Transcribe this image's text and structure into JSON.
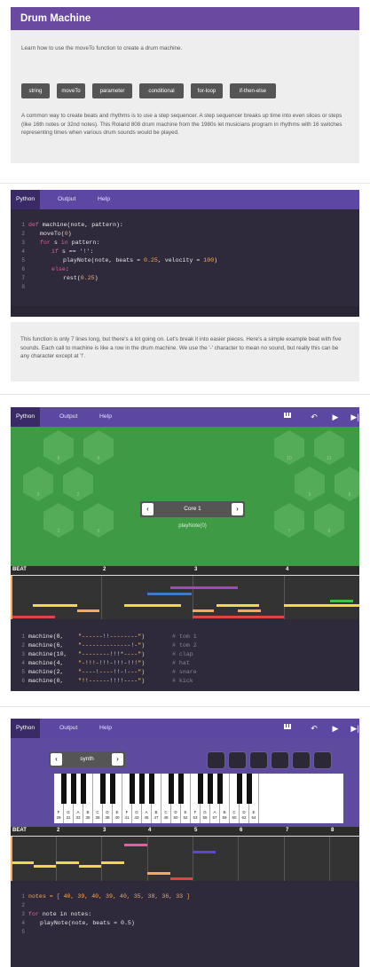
{
  "lesson": {
    "title": "Drum Machine",
    "intro": "Learn how to use the moveTo function to create a drum machine.",
    "tags": [
      "string",
      "moveTo",
      "parameter",
      "conditional",
      "for-loop",
      "if-then-else"
    ],
    "body": "A common way to create beats and rhythms is to use a step sequencer. A step sequencer breaks up time into even slices or steps (like 16th notes or 32nd notes). This Roland 808 drum machine from the 1980s let musicians program in rhythms with 16 switches representing times when various drum sounds would be played."
  },
  "editor1": {
    "tabs": [
      "Python",
      "Output",
      "Help"
    ],
    "active_tab": "Python",
    "line_numbers": [
      "1",
      "2",
      "3",
      "4",
      "5",
      "6",
      "7",
      "8"
    ]
  },
  "paragraph": "This function is only 7 lines long, but there's a lot going on. Let's break it into easier pieces. Here's a simple example beat with five sounds. Each call to machine is like a row in the drum machine. We use the '-' character to mean no sound, but really this can be any character except at '!'.",
  "editor2": {
    "tabs": [
      "Python",
      "Output",
      "Help"
    ],
    "controls": [
      "piano-icon",
      "undo-icon",
      "play-icon",
      "step-icon"
    ],
    "core_label": "Core 1",
    "core_status": "playNote(0)",
    "hex_numbers": [
      "6",
      "5",
      "3",
      "2",
      "1",
      "0",
      "10",
      "11",
      "9",
      "8",
      "7",
      "6"
    ],
    "beat_label": "BEAT",
    "beat_numbers": [
      "2",
      "3",
      "4"
    ],
    "code_lines": [
      {
        "n": "1",
        "call": "machine(8,",
        "pat": "\"------!!--------\")",
        "cmt": "# tom 1"
      },
      {
        "n": "2",
        "call": "machine(6,",
        "pat": "\"--------------!-\")",
        "cmt": "# tom 2"
      },
      {
        "n": "3",
        "call": "machine(10,",
        "pat": "\"--------!!!*----\")",
        "cmt": "# clap"
      },
      {
        "n": "4",
        "call": "machine(4,",
        "pat": "\"-!!!-!!!-!!!-!!!\")",
        "cmt": "# hat"
      },
      {
        "n": "5",
        "call": "machine(2,",
        "pat": "\"----!----!!-!---\")",
        "cmt": "# snare"
      },
      {
        "n": "6",
        "call": "machine(0,",
        "pat": "\"!!------!!!!----\")",
        "cmt": "# kick"
      }
    ]
  },
  "editor3": {
    "tabs": [
      "Python",
      "Output",
      "Help"
    ],
    "controls": [
      "piano-icon",
      "undo-icon",
      "play-icon",
      "step-icon"
    ],
    "instrument": "synth",
    "keys_notes": [
      "F",
      "G",
      "A",
      "B",
      "C",
      "D",
      "E",
      "F",
      "G",
      "A",
      "B",
      "C",
      "D",
      "E",
      "F",
      "G",
      "A",
      "B",
      "C",
      "D",
      "E",
      "F",
      "G",
      "A",
      "B",
      "C",
      "D",
      "E",
      "F",
      "G",
      "A",
      "B",
      "C",
      "D",
      "E"
    ],
    "keys_numbers": [
      "29",
      "31",
      "33",
      "35",
      "36",
      "38",
      "40",
      "41",
      "43",
      "45",
      "47",
      "48",
      "50",
      "52",
      "53",
      "55",
      "57",
      "59",
      "60",
      "62",
      "64"
    ],
    "beat_label": "BEAT",
    "beat_numbers": [
      "2",
      "3",
      "4",
      "5",
      "6",
      "7",
      "8"
    ],
    "code_lines": [
      "1",
      "2",
      "3",
      "4",
      "5"
    ],
    "line1": "notes = [ 40, 39, 40, 39, 40, 35, 38, 36, 33 ]",
    "line3_kw": "for",
    "line3_rest": " note in notes:",
    "line4": "playNote(note, beats = 0.5)"
  },
  "colors": {
    "purple": "#5c47a3",
    "dark": "#2f2a3b",
    "green": "#3e9a44",
    "keyword": "#e45ea0",
    "string": "#ffd45e",
    "number": "#f7a95a"
  }
}
